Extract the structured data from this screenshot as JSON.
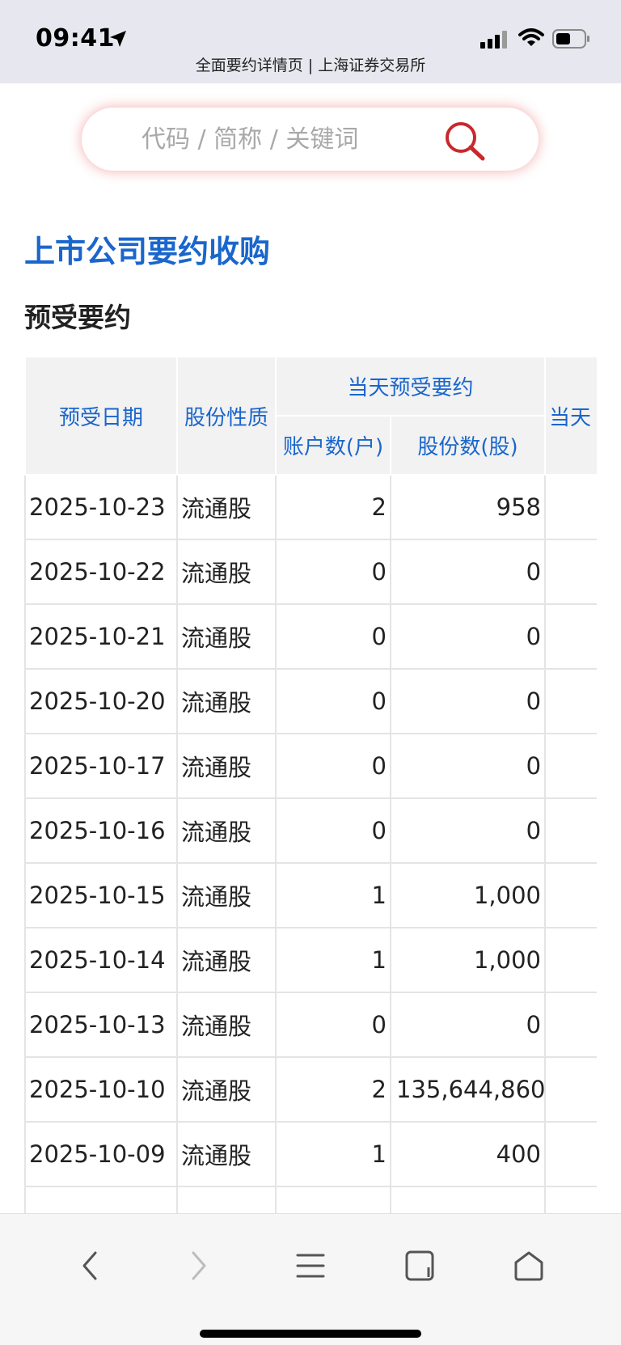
{
  "status_bar": {
    "time": "09:41"
  },
  "page_title": "全面要约详情页 | 上海证券交易所",
  "search": {
    "placeholder": "代码 / 简称 / 关键词"
  },
  "section_title": "上市公司要约收购",
  "sub_title": "预受要约",
  "table": {
    "headers": {
      "date": "预受日期",
      "share_type": "股份性质",
      "group_today": "当天预受要约",
      "accounts": "账户数(户)",
      "shares": "股份数(股)",
      "next_col": "当天"
    },
    "rows": [
      {
        "date": "2025-10-23",
        "type": "流通股",
        "accounts": "2",
        "shares": "958"
      },
      {
        "date": "2025-10-22",
        "type": "流通股",
        "accounts": "0",
        "shares": "0"
      },
      {
        "date": "2025-10-21",
        "type": "流通股",
        "accounts": "0",
        "shares": "0"
      },
      {
        "date": "2025-10-20",
        "type": "流通股",
        "accounts": "0",
        "shares": "0"
      },
      {
        "date": "2025-10-17",
        "type": "流通股",
        "accounts": "0",
        "shares": "0"
      },
      {
        "date": "2025-10-16",
        "type": "流通股",
        "accounts": "0",
        "shares": "0"
      },
      {
        "date": "2025-10-15",
        "type": "流通股",
        "accounts": "1",
        "shares": "1,000"
      },
      {
        "date": "2025-10-14",
        "type": "流通股",
        "accounts": "1",
        "shares": "1,000"
      },
      {
        "date": "2025-10-13",
        "type": "流通股",
        "accounts": "0",
        "shares": "0"
      },
      {
        "date": "2025-10-10",
        "type": "流通股",
        "accounts": "2",
        "shares": "135,644,860"
      },
      {
        "date": "2025-10-09",
        "type": "流通股",
        "accounts": "1",
        "shares": "400"
      },
      {
        "date": "",
        "type": "",
        "accounts": "",
        "shares": ""
      }
    ]
  },
  "toolbar": {
    "icons": [
      "back-icon",
      "forward-icon",
      "menu-icon",
      "tabs-icon",
      "home-icon"
    ]
  },
  "colors": {
    "accent": "#1a66cc",
    "search_glow": "#e64646",
    "search_icon": "#c8282d"
  }
}
